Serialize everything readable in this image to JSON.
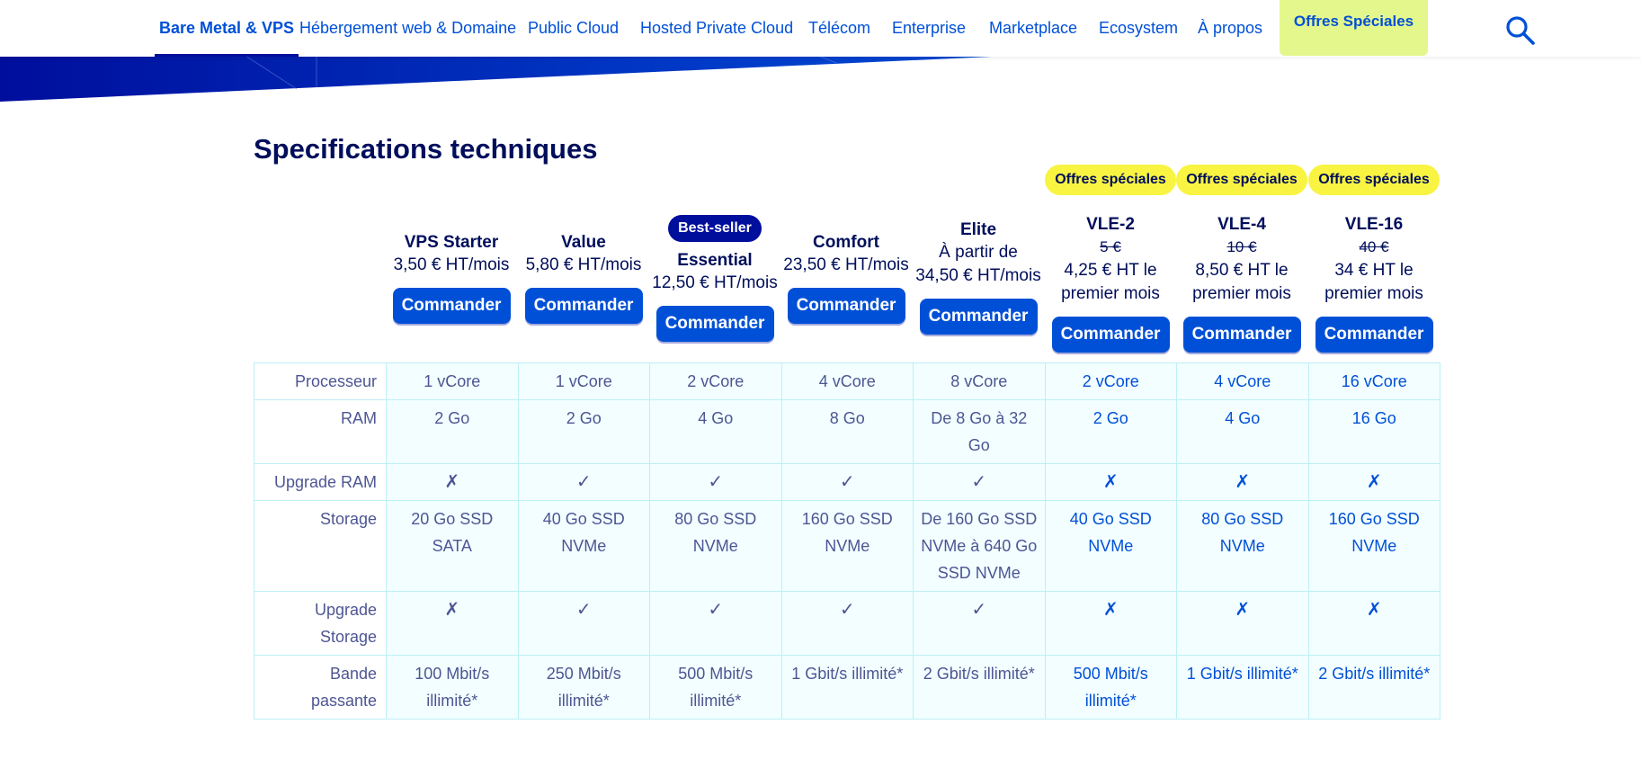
{
  "nav": {
    "items": [
      {
        "label": "Bare Metal & VPS",
        "active": true
      },
      {
        "label": "Hébergement web & Domaine"
      },
      {
        "label": "Public Cloud"
      },
      {
        "label": "Hosted Private Cloud"
      },
      {
        "label": "Télécom"
      },
      {
        "label": "Enterprise"
      },
      {
        "label": "Marketplace"
      },
      {
        "label": "Ecosystem"
      },
      {
        "label": "À propos"
      }
    ],
    "offers_label": "Offres Spéciales",
    "search_icon": "search-icon"
  },
  "colors": {
    "brand_blue": "#000e9c",
    "link_blue": "#0050d7",
    "offer_yellow": "#f8f441",
    "nav_offer_green": "#e4f78c",
    "cell_bg": "#f2feff"
  },
  "section": {
    "title": "Specifications techniques"
  },
  "plans": [
    {
      "name": "VPS Starter",
      "price": "3,50 € HT/mois",
      "order": "Commander"
    },
    {
      "name": "Value",
      "price": "5,80 € HT/mois",
      "order": "Commander"
    },
    {
      "name": "Essential",
      "badge": "Best-seller",
      "price": "12,50 € HT/mois",
      "order": "Commander"
    },
    {
      "name": "Comfort",
      "price": "23,50 € HT/mois",
      "order": "Commander"
    },
    {
      "name": "Elite",
      "prefix": "À partir de",
      "price": "34,50 € HT/mois",
      "order": "Commander"
    },
    {
      "name": "VLE-2",
      "badge": "Offres spéciales",
      "old_price": "5 €",
      "price_line1": "4,25 € HT le",
      "price_line2": "premier mois",
      "order": "Commander"
    },
    {
      "name": "VLE-4",
      "badge": "Offres spéciales",
      "old_price": "10 €",
      "price_line1": "8,50 € HT le",
      "price_line2": "premier mois",
      "order": "Commander"
    },
    {
      "name": "VLE-16",
      "badge": "Offres spéciales",
      "old_price": "40 €",
      "price_line1": "34 € HT le",
      "price_line2": "premier mois",
      "order": "Commander"
    }
  ],
  "specs": {
    "processor": {
      "label": "Processeur",
      "values": [
        "1 vCore",
        "1 vCore",
        "2 vCore",
        "4 vCore",
        "8 vCore",
        "2 vCore",
        "4 vCore",
        "16 vCore"
      ]
    },
    "ram": {
      "label": "RAM",
      "values": [
        "2 Go",
        "2 Go",
        "4 Go",
        "8 Go",
        "De 8 Go à 32 Go",
        "2 Go",
        "4 Go",
        "16 Go"
      ]
    },
    "upgrade_ram": {
      "label": "Upgrade RAM",
      "values": [
        "✗",
        "✓",
        "✓",
        "✓",
        "✓",
        "✗",
        "✗",
        "✗"
      ]
    },
    "storage": {
      "label": "Storage",
      "values": [
        "20 Go SSD SATA",
        "40 Go SSD NVMe",
        "80 Go SSD NVMe",
        "160 Go SSD NVMe",
        "De 160 Go SSD NVMe à 640 Go SSD NVMe",
        "40 Go SSD NVMe",
        "80 Go SSD NVMe",
        "160 Go SSD NVMe"
      ]
    },
    "upgrade_storage": {
      "label": "Upgrade Storage",
      "values": [
        "✗",
        "✓",
        "✓",
        "✓",
        "✓",
        "✗",
        "✗",
        "✗"
      ]
    },
    "bandwidth": {
      "label": "Bande passante",
      "values": [
        "100 Mbit/s illimité*",
        "250 Mbit/s illimité*",
        "500 Mbit/s illimité*",
        "1 Gbit/s illimité*",
        "2 Gbit/s illimité*",
        "500 Mbit/s illimité*",
        "1 Gbit/s illimité*",
        "2 Gbit/s illimité*"
      ]
    }
  }
}
